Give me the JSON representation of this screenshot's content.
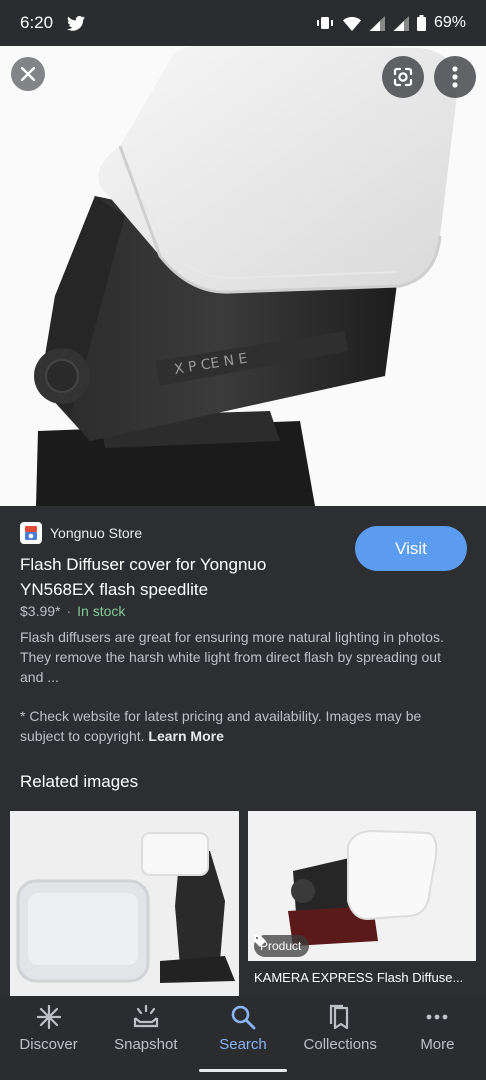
{
  "status_bar": {
    "time": "6:20",
    "battery": "69%",
    "icons": [
      "twitter-icon",
      "vibrate-icon",
      "wifi-icon",
      "signal-icon",
      "signal-icon",
      "battery-icon"
    ]
  },
  "hero": {
    "close_icon": "close-icon",
    "lens_icon": "google-lens-icon",
    "menu_icon": "more-vert-icon"
  },
  "result": {
    "store_name": "Yongnuo Store",
    "visit_label": "Visit",
    "title": "Flash Diffuser cover for Yongnuo YN568EX flash speedlite",
    "price": "$3.99*",
    "separator": "·",
    "stock": "In stock",
    "description": "Flash diffusers are great for ensuring more natural lighting in photos. They remove the harsh white light from direct flash by spreading out and ...",
    "disclaimer": "* Check website for latest pricing and availability. Images may be subject to copyright.",
    "learn_more": "Learn More"
  },
  "related": {
    "title": "Related images",
    "items": [
      {
        "tag": "",
        "caption": ""
      },
      {
        "tag": "Product",
        "caption": "KAMERA EXPRESS Flash Diffuse..."
      }
    ]
  },
  "nav": {
    "items": [
      {
        "label": "Discover",
        "icon": "discover-icon"
      },
      {
        "label": "Snapshot",
        "icon": "snapshot-icon"
      },
      {
        "label": "Search",
        "icon": "search-icon"
      },
      {
        "label": "Collections",
        "icon": "collections-icon"
      },
      {
        "label": "More",
        "icon": "more-horiz-icon"
      }
    ],
    "active": "Search"
  },
  "colors": {
    "accent": "#8ab4f8",
    "visit_button": "#5b9cf0",
    "in_stock": "#81c995",
    "panel": "#2d2e32"
  }
}
